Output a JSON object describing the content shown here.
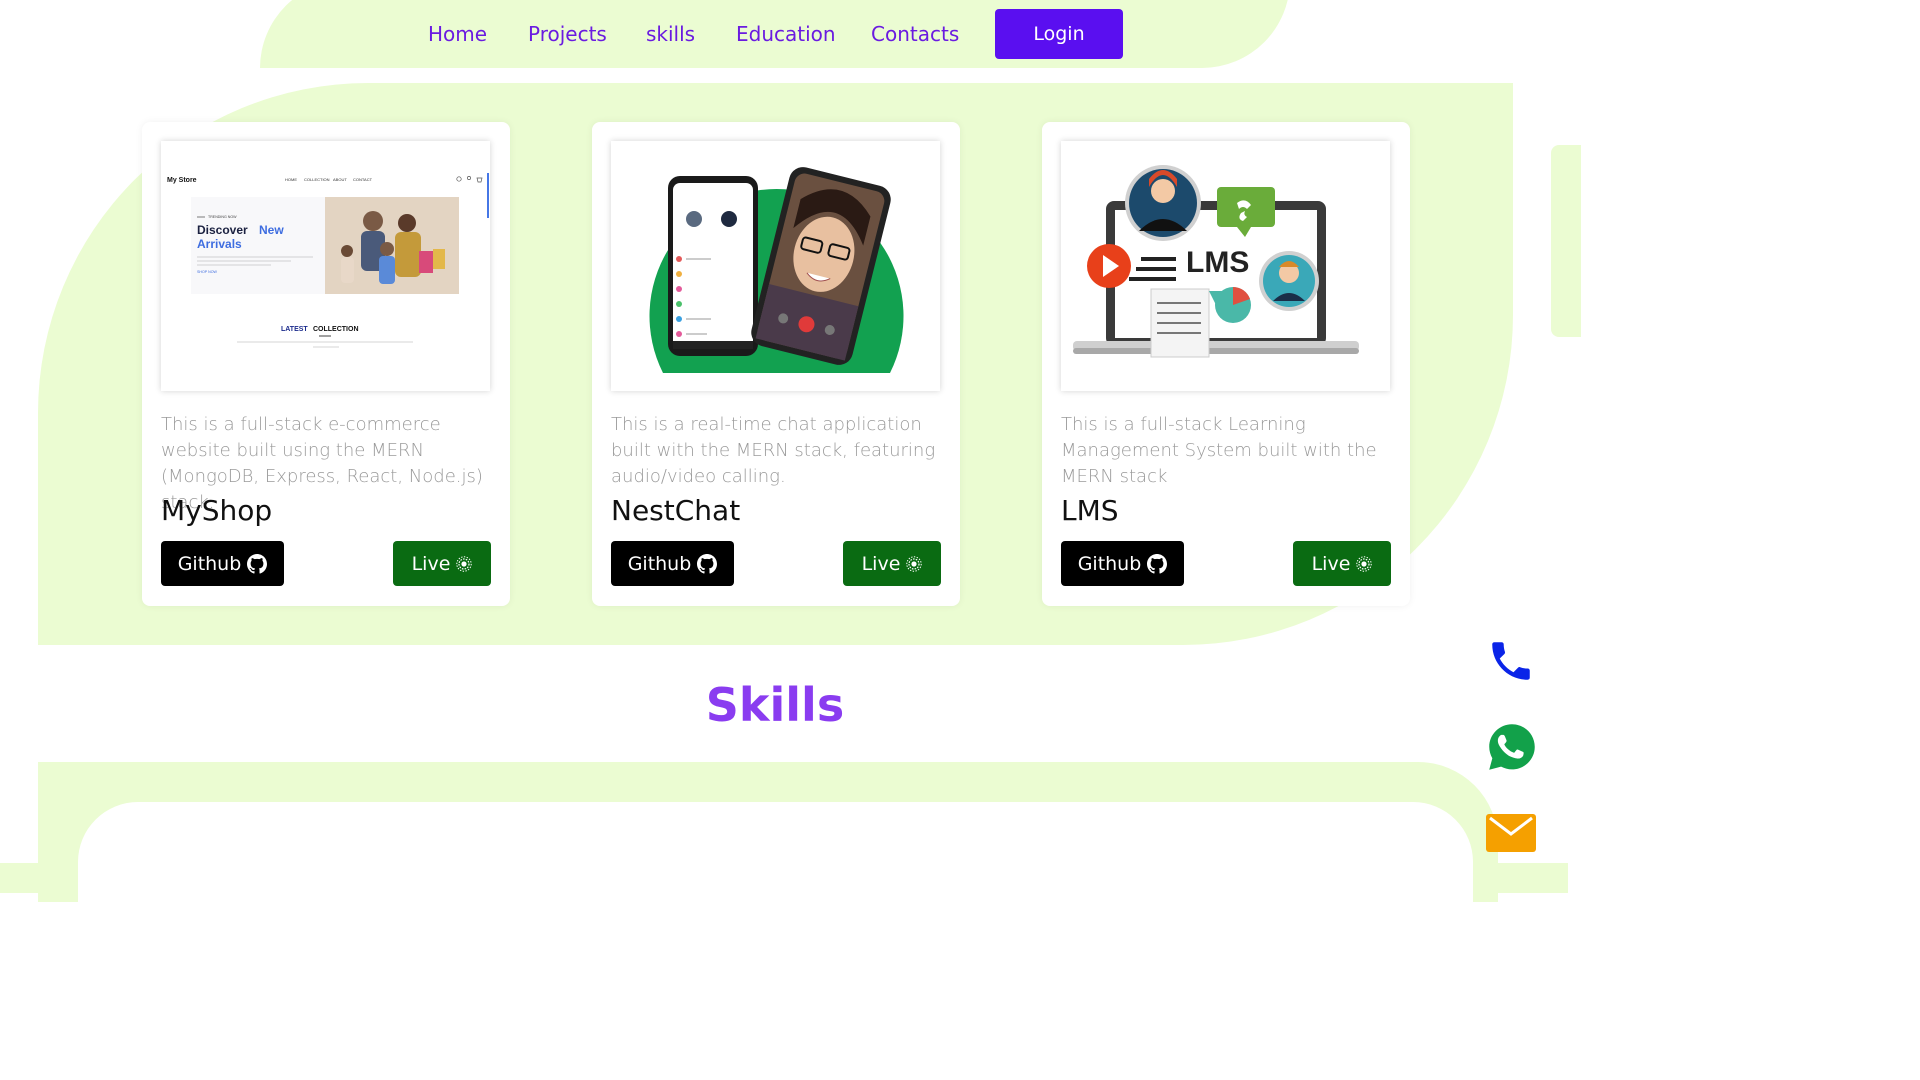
{
  "nav": {
    "items": [
      "Home",
      "Projects",
      "skills",
      "Education",
      "Contacts"
    ],
    "login_label": "Login"
  },
  "projects": [
    {
      "description": "This is a full-stack e-commerce website built using the MERN (MongoDB, Express, React, Node.js) stack.",
      "title": "MyShop",
      "github_label": "Github",
      "live_label": "Live",
      "screenshot": {
        "brand": "My Store",
        "menu": [
          "HOME",
          "COLLECTION",
          "ABOUT",
          "CONTACT"
        ],
        "trending": "TRENDING NOW",
        "headline_1": "Discover",
        "headline_2": "New",
        "headline_3": "Arrivals",
        "shop_now": "SHOP NOW",
        "latest": "LATEST",
        "collection": "COLLECTION"
      }
    },
    {
      "description": "This is a real-time chat application built with the MERN stack, featuring audio/video calling.",
      "title": "NestChat",
      "github_label": "Github",
      "live_label": "Live"
    },
    {
      "description": "This is a full-stack Learning Management System built with the MERN stack",
      "title": "LMS",
      "github_label": "Github",
      "live_label": "Live",
      "screenshot": {
        "screen_text": "LMS"
      }
    }
  ],
  "skills": {
    "title": "Skills"
  },
  "colors": {
    "accent": "#5a0ff0",
    "nav_text": "#6a1be0",
    "blob": "#ebfcd2",
    "live_button": "#0a6b12",
    "skills_title": "#8a3cf0"
  },
  "floating_icons": [
    "phone-icon",
    "whatsapp-icon",
    "mail-icon"
  ]
}
